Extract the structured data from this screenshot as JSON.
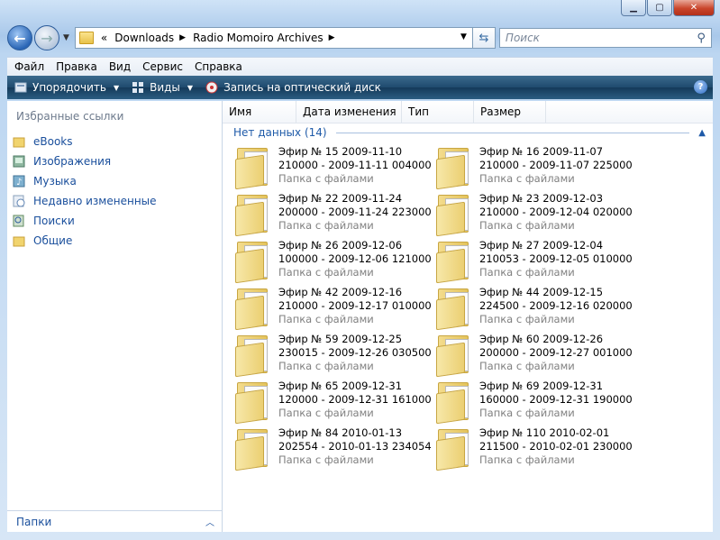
{
  "address": {
    "path_segments": [
      "Downloads",
      "Radio Momoiro Archives"
    ],
    "overflow_marker": "«"
  },
  "search": {
    "placeholder": "Поиск"
  },
  "menu": [
    "Файл",
    "Правка",
    "Вид",
    "Сервис",
    "Справка"
  ],
  "toolbar": {
    "organize": "Упорядочить",
    "views": "Виды",
    "burn": "Запись на оптический диск"
  },
  "sidebar": {
    "title": "Избранные ссылки",
    "items": [
      {
        "label": "eBooks",
        "icon": "folder-icon"
      },
      {
        "label": "Изображения",
        "icon": "pictures-icon"
      },
      {
        "label": "Музыка",
        "icon": "music-icon"
      },
      {
        "label": "Недавно измененные",
        "icon": "recent-icon"
      },
      {
        "label": "Поиски",
        "icon": "searches-icon"
      },
      {
        "label": "Общие",
        "icon": "folder-icon"
      }
    ],
    "folders_label": "Папки"
  },
  "columns": [
    "Имя",
    "Дата изменения",
    "Тип",
    "Размер"
  ],
  "group": {
    "label": "Нет данных (14)"
  },
  "items": [
    {
      "line1": "Эфир № 15 2009-11-10",
      "line2": "210000 - 2009-11-11 004000",
      "type": "Папка с файлами"
    },
    {
      "line1": "Эфир № 16 2009-11-07",
      "line2": "210000 - 2009-11-07 225000",
      "type": "Папка с файлами"
    },
    {
      "line1": "Эфир № 22 2009-11-24",
      "line2": "200000 - 2009-11-24 223000",
      "type": "Папка с файлами"
    },
    {
      "line1": "Эфир № 23 2009-12-03",
      "line2": "210000 - 2009-12-04 020000",
      "type": "Папка с файлами"
    },
    {
      "line1": "Эфир № 26 2009-12-06",
      "line2": "100000 - 2009-12-06 121000",
      "type": "Папка с файлами"
    },
    {
      "line1": "Эфир № 27 2009-12-04",
      "line2": "210053 - 2009-12-05 010000",
      "type": "Папка с файлами"
    },
    {
      "line1": "Эфир № 42 2009-12-16",
      "line2": "210000 - 2009-12-17 010000",
      "type": "Папка с файлами"
    },
    {
      "line1": "Эфир № 44 2009-12-15",
      "line2": "224500 - 2009-12-16 020000",
      "type": "Папка с файлами"
    },
    {
      "line1": "Эфир № 59 2009-12-25",
      "line2": "230015 - 2009-12-26 030500",
      "type": "Папка с файлами"
    },
    {
      "line1": "Эфир № 60 2009-12-26",
      "line2": "200000 - 2009-12-27 001000",
      "type": "Папка с файлами"
    },
    {
      "line1": "Эфир № 65 2009-12-31",
      "line2": "120000 - 2009-12-31 161000",
      "type": "Папка с файлами"
    },
    {
      "line1": "Эфир № 69 2009-12-31",
      "line2": "160000 - 2009-12-31 190000",
      "type": "Папка с файлами"
    },
    {
      "line1": "Эфир № 84 2010-01-13",
      "line2": "202554 - 2010-01-13 234054",
      "type": "Папка с файлами"
    },
    {
      "line1": "Эфир № 110 2010-02-01",
      "line2": "211500 - 2010-02-01 230000",
      "type": "Папка с файлами"
    }
  ]
}
